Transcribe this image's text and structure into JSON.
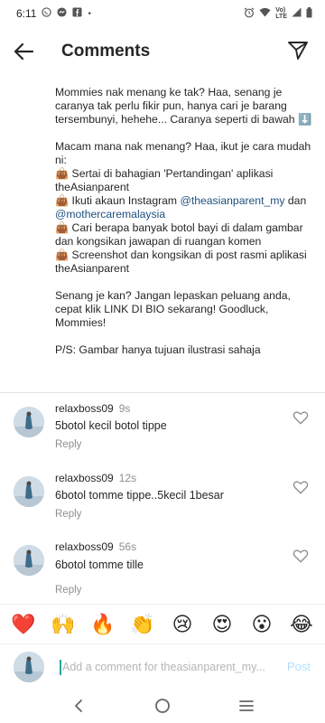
{
  "status_bar": {
    "time": "6:11",
    "left_icons": [
      "whatsapp-icon",
      "messenger-icon",
      "facebook-icon",
      "dot-icon"
    ],
    "right_icons": [
      "alarm-icon",
      "wifi-icon",
      "volte-icon",
      "signal-icon",
      "battery-icon"
    ],
    "volte_label_top": "Vo)",
    "volte_label_bottom": "LTE"
  },
  "header": {
    "title": "Comments",
    "back_icon": "arrow-left-icon",
    "share_icon": "paper-plane-icon"
  },
  "caption": {
    "p1": "Mommies nak menang ke tak? Haa, senang je caranya tak perlu fikir pun, hanya cari je barang tersembunyi, hehehe... Caranya seperti di bawah ⬇️",
    "p2": "Macam mana nak menang? Haa, ikut je cara mudah ni:",
    "step1": "👜 Sertai di bahagian 'Pertandingan' aplikasi theAsianparent",
    "step2_prefix": "👜 Ikuti akaun Instagram ",
    "step2_mention1": "@theasianparent_my",
    "step2_mid": " dan ",
    "step2_mention2": "@mothercaremalaysia",
    "step3": "👜 Cari berapa banyak botol bayi di dalam gambar dan kongsikan jawapan di ruangan komen",
    "step4": "👜 Screenshot dan kongsikan di post rasmi aplikasi theAsianparent",
    "p3": "Senang je kan? Jangan lepaskan peluang anda, cepat klik LINK DI BIO sekarang! Goodluck, Mommies!",
    "p4": "P/S: Gambar hanya tujuan ilustrasi sahaja"
  },
  "comments": [
    {
      "username": "relaxboss09",
      "time": "9s",
      "text": "5botol kecil botol tippe",
      "reply_label": "Reply"
    },
    {
      "username": "relaxboss09",
      "time": "12s",
      "text": "6botol tomme tippe..5kecil 1besar",
      "reply_label": "Reply"
    },
    {
      "username": "relaxboss09",
      "time": "56s",
      "text": "6botol tomme tille",
      "reply_label": "Reply"
    }
  ],
  "emoji_bar": [
    "❤️",
    "🙌",
    "🔥",
    "👏",
    "😢",
    "😍",
    "😮",
    "😂"
  ],
  "input": {
    "placeholder": "Add a comment for theasianparent_my...",
    "post_label": "Post"
  },
  "nav": [
    "back-nav-icon",
    "home-nav-icon",
    "recents-nav-icon"
  ],
  "colors": {
    "mention": "#1e4f80",
    "post_disabled": "#b2dffc",
    "secondary_text": "#8e8e8e",
    "cursor": "#2aa59b"
  }
}
